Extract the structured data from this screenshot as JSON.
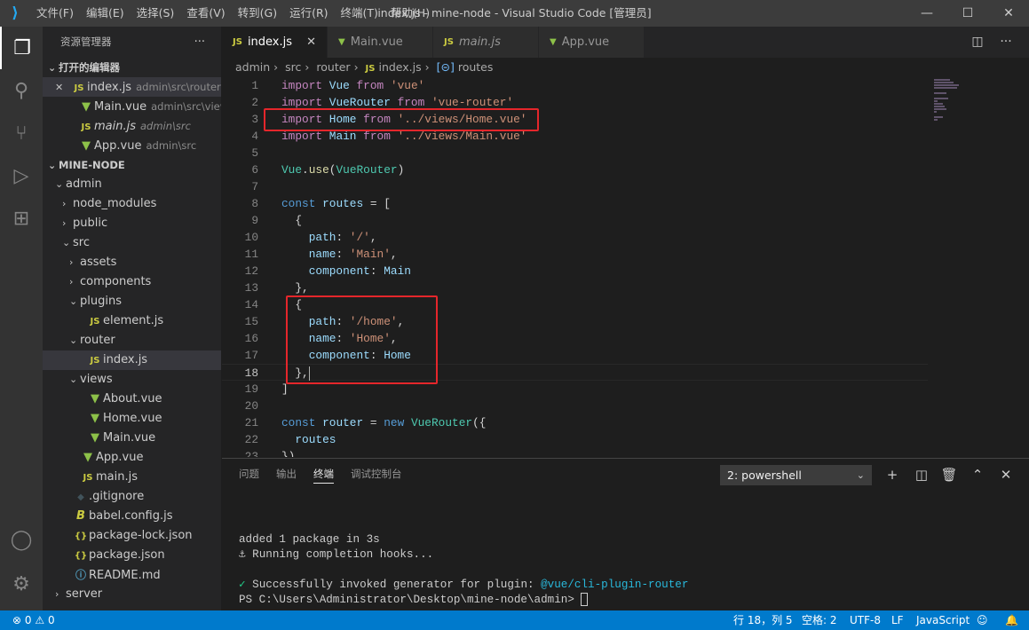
{
  "titlebar": {
    "title": "index.js - mine-node - Visual Studio Code [管理员]",
    "menu": [
      "文件(F)",
      "编辑(E)",
      "选择(S)",
      "查看(V)",
      "转到(G)",
      "运行(R)",
      "终端(T)",
      "帮助(H)"
    ]
  },
  "activity_bar": [
    "explorer-icon",
    "search-icon",
    "source-control-icon",
    "run-debug-icon",
    "extensions-icon",
    "account-icon",
    "settings-gear-icon"
  ],
  "sidebar": {
    "title": "资源管理器",
    "more": "···",
    "rows": [
      {
        "chev": "open",
        "label": "打开的编辑器",
        "section": true,
        "indent": 0
      },
      {
        "close": true,
        "icon": "js",
        "label": "index.js",
        "desc": "admin\\src\\router",
        "indent": 1,
        "selected": true
      },
      {
        "icon": "vue",
        "label": "Main.vue",
        "desc": "admin\\src\\views",
        "indent": 2
      },
      {
        "icon": "js",
        "label": "main.js",
        "desc": "admin\\src",
        "indent": 2,
        "italic": true
      },
      {
        "icon": "vue",
        "label": "App.vue",
        "desc": "admin\\src",
        "indent": 2
      },
      {
        "chev": "open",
        "label": "MINE-NODE",
        "section": true,
        "indent": 0
      },
      {
        "chev": "open",
        "label": "admin",
        "indent": 1
      },
      {
        "chev": "closed",
        "label": "node_modules",
        "indent": 2
      },
      {
        "chev": "closed",
        "label": "public",
        "indent": 2
      },
      {
        "chev": "open",
        "label": "src",
        "indent": 2
      },
      {
        "chev": "closed",
        "label": "assets",
        "indent": 3
      },
      {
        "chev": "closed",
        "label": "components",
        "indent": 3
      },
      {
        "chev": "open",
        "label": "plugins",
        "indent": 3
      },
      {
        "icon": "js",
        "label": "element.js",
        "indent": 4
      },
      {
        "chev": "open",
        "label": "router",
        "indent": 3
      },
      {
        "icon": "js",
        "label": "index.js",
        "indent": 4,
        "selected": true
      },
      {
        "chev": "open",
        "label": "views",
        "indent": 3
      },
      {
        "icon": "vue",
        "label": "About.vue",
        "indent": 4
      },
      {
        "icon": "vue",
        "label": "Home.vue",
        "indent": 4
      },
      {
        "icon": "vue",
        "label": "Main.vue",
        "indent": 4
      },
      {
        "icon": "vue",
        "label": "App.vue",
        "indent": 3
      },
      {
        "icon": "js",
        "label": "main.js",
        "indent": 3
      },
      {
        "icon": "git",
        "label": ".gitignore",
        "indent": 2
      },
      {
        "icon": "babel",
        "label": "babel.config.js",
        "indent": 2
      },
      {
        "icon": "json",
        "label": "package-lock.json",
        "indent": 2
      },
      {
        "icon": "json",
        "label": "package.json",
        "indent": 2
      },
      {
        "icon": "info",
        "label": "README.md",
        "indent": 2
      },
      {
        "chev": "closed",
        "label": "server",
        "indent": 1
      }
    ]
  },
  "icons": {
    "js": "JS",
    "vue": "▼",
    "json": "{}",
    "git": "◆",
    "babel": "B",
    "info": "ⓘ"
  },
  "tabs": [
    {
      "icon": "js",
      "label": "index.js",
      "active": true,
      "close": "✕"
    },
    {
      "icon": "vue",
      "label": "Main.vue"
    },
    {
      "icon": "js",
      "label": "main.js",
      "italic": true
    },
    {
      "icon": "vue",
      "label": "App.vue"
    }
  ],
  "breadcrumb": [
    "admin",
    "src",
    "router",
    "index.js",
    "routes"
  ],
  "editor": {
    "cursor_line": 18,
    "lines": [
      [
        [
          "k",
          "import"
        ],
        [
          "p",
          " "
        ],
        [
          "v",
          "Vue"
        ],
        [
          "p",
          " "
        ],
        [
          "k",
          "from"
        ],
        [
          "p",
          " "
        ],
        [
          "s",
          "'vue'"
        ]
      ],
      [
        [
          "k",
          "import"
        ],
        [
          "p",
          " "
        ],
        [
          "v",
          "VueRouter"
        ],
        [
          "p",
          " "
        ],
        [
          "k",
          "from"
        ],
        [
          "p",
          " "
        ],
        [
          "s",
          "'vue-router'"
        ]
      ],
      [
        [
          "k",
          "import"
        ],
        [
          "p",
          " "
        ],
        [
          "v",
          "Home"
        ],
        [
          "p",
          " "
        ],
        [
          "k",
          "from"
        ],
        [
          "p",
          " "
        ],
        [
          "s",
          "'../views/Home.vue'"
        ]
      ],
      [
        [
          "k",
          "import"
        ],
        [
          "p",
          " "
        ],
        [
          "v",
          "Main"
        ],
        [
          "p",
          " "
        ],
        [
          "k",
          "from"
        ],
        [
          "p",
          " "
        ],
        [
          "s",
          "'../views/Main.vue'"
        ]
      ],
      [],
      [
        [
          "c",
          "Vue"
        ],
        [
          "p",
          "."
        ],
        [
          "f",
          "use"
        ],
        [
          "p",
          "("
        ],
        [
          "c",
          "VueRouter"
        ],
        [
          "p",
          ")"
        ]
      ],
      [],
      [
        [
          "b",
          "const"
        ],
        [
          "p",
          " "
        ],
        [
          "v",
          "routes"
        ],
        [
          "p",
          " = ["
        ]
      ],
      [
        [
          "p",
          "  {"
        ]
      ],
      [
        [
          "p",
          "    "
        ],
        [
          "v",
          "path"
        ],
        [
          "p",
          ": "
        ],
        [
          "s",
          "'/'"
        ],
        [
          "p",
          ","
        ]
      ],
      [
        [
          "p",
          "    "
        ],
        [
          "v",
          "name"
        ],
        [
          "p",
          ": "
        ],
        [
          "s",
          "'Main'"
        ],
        [
          "p",
          ","
        ]
      ],
      [
        [
          "p",
          "    "
        ],
        [
          "v",
          "component"
        ],
        [
          "p",
          ": "
        ],
        [
          "v",
          "Main"
        ]
      ],
      [
        [
          "p",
          "  },"
        ]
      ],
      [
        [
          "p",
          "  {"
        ]
      ],
      [
        [
          "p",
          "    "
        ],
        [
          "v",
          "path"
        ],
        [
          "p",
          ": "
        ],
        [
          "s",
          "'/home'"
        ],
        [
          "p",
          ","
        ]
      ],
      [
        [
          "p",
          "    "
        ],
        [
          "v",
          "name"
        ],
        [
          "p",
          ": "
        ],
        [
          "s",
          "'Home'"
        ],
        [
          "p",
          ","
        ]
      ],
      [
        [
          "p",
          "    "
        ],
        [
          "v",
          "component"
        ],
        [
          "p",
          ": "
        ],
        [
          "v",
          "Home"
        ]
      ],
      [
        [
          "p",
          "  },"
        ]
      ],
      [
        [
          "p",
          "]"
        ]
      ],
      [],
      [
        [
          "b",
          "const"
        ],
        [
          "p",
          " "
        ],
        [
          "v",
          "router"
        ],
        [
          "p",
          " = "
        ],
        [
          "b",
          "new"
        ],
        [
          "p",
          " "
        ],
        [
          "c",
          "VueRouter"
        ],
        [
          "p",
          "({"
        ]
      ],
      [
        [
          "p",
          "  "
        ],
        [
          "v",
          "routes"
        ]
      ],
      [
        [
          "p",
          "})"
        ]
      ]
    ]
  },
  "panel": {
    "tabs": [
      "问题",
      "输出",
      "终端",
      "调试控制台"
    ],
    "active_tab": "终端",
    "terminal_select": "2: powershell",
    "actions": [
      "add-icon",
      "split-icon",
      "trash-icon",
      "maximize-icon",
      "close-icon"
    ],
    "terminal": {
      "line1": "added 1 package in 3s",
      "line2_icon": "⚓",
      "line2": " Running completion hooks...",
      "line3_icon": "✓",
      "line3": " Successfully invoked generator for plugin: ",
      "line3_link": "@vue/cli-plugin-router",
      "line4": "PS C:\\Users\\Administrator\\Desktop\\mine-node\\admin> "
    }
  },
  "status": {
    "errors": "0",
    "warnings": "0",
    "position": "行 18，列 5",
    "spaces": "空格: 2",
    "encoding": "UTF-8",
    "eol": "LF",
    "language": "JavaScript"
  },
  "colors": {
    "accent": "#007acc",
    "highlight_box": "#e5262b"
  }
}
